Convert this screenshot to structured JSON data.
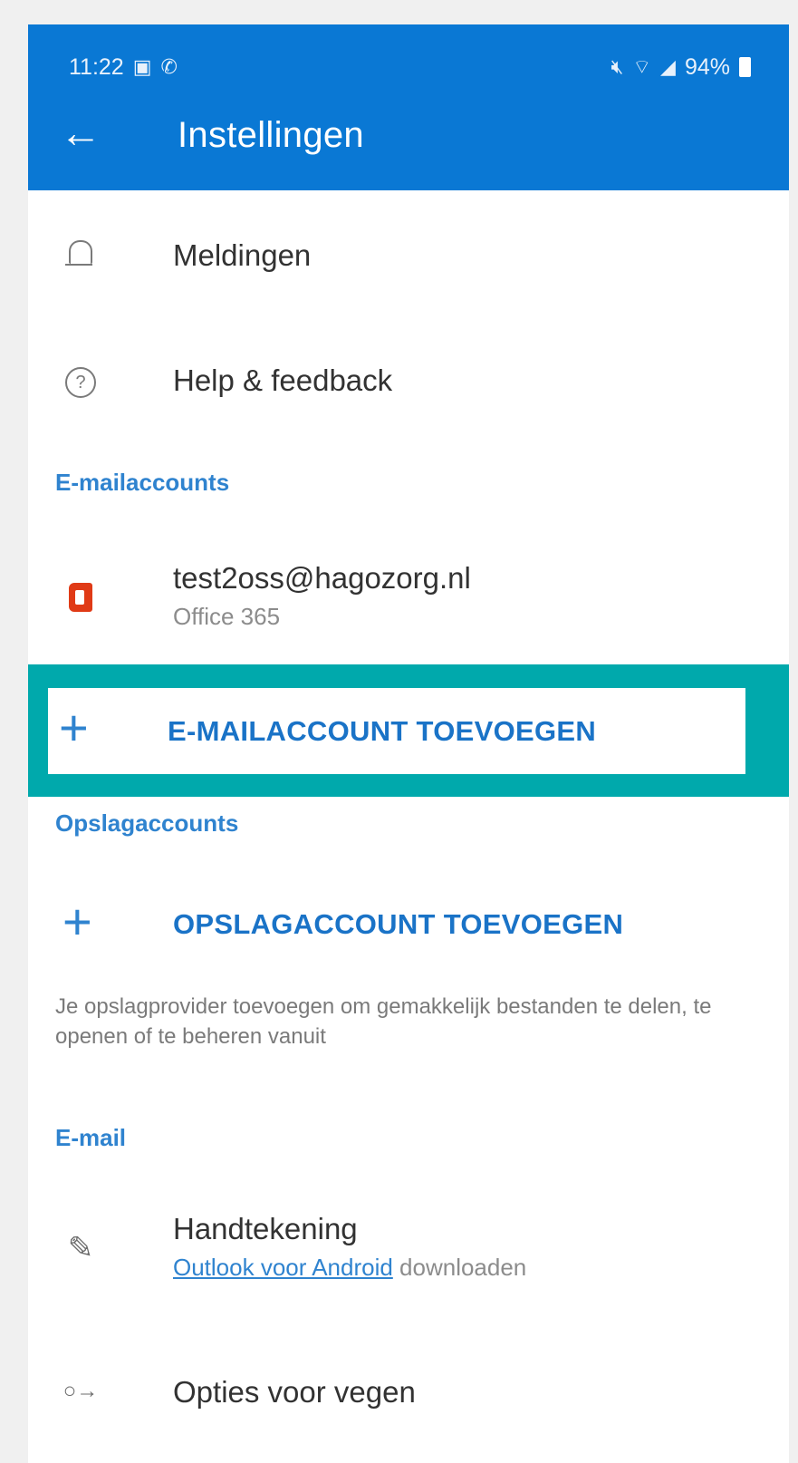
{
  "status_bar": {
    "time": "11:22",
    "left_icons": [
      "gallery-icon",
      "whatsapp-icon"
    ],
    "right_icons": [
      "mute-icon",
      "wifi-icon",
      "signal-icon"
    ],
    "battery": "94%"
  },
  "app_bar": {
    "title": "Instellingen",
    "color": "#0a78d4"
  },
  "settings": {
    "notifications": {
      "label": "Meldingen",
      "icon": "bell-icon"
    },
    "help": {
      "label": "Help & feedback",
      "icon": "help-icon"
    }
  },
  "email_accounts": {
    "header": "E-mailaccounts",
    "account": {
      "email": "test2oss@hagozorg.nl",
      "type": "Office 365",
      "icon": "office-365-icon"
    },
    "add_label": "E-MAILACCOUNT TOEVOEGEN",
    "highlight_color": "#00a9ac"
  },
  "storage_accounts": {
    "header": "Opslagaccounts",
    "add_label": "OPSLAGACCOUNT TOEVOEGEN",
    "description": "Je opslagprovider toevoegen om gemakkelijk bestanden te delen, te openen of te beheren vanuit"
  },
  "email": {
    "header": "E-mail",
    "signature": {
      "label": "Handtekening",
      "link_text": "Outlook voor Android",
      "suffix": " downloaden",
      "icon": "pen-icon"
    },
    "swipe_options": {
      "label": "Opties voor vegen",
      "icon": "swipe-icon"
    }
  }
}
